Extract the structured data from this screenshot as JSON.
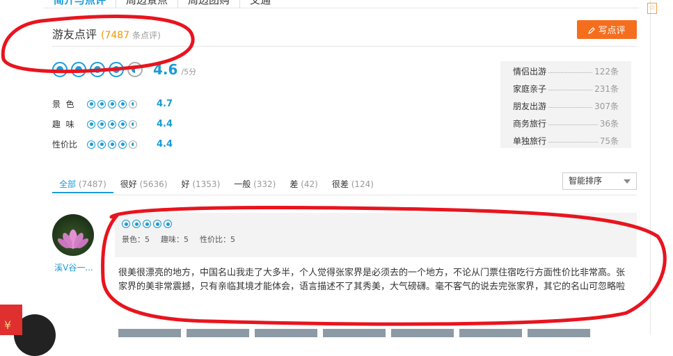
{
  "top_tabs": [
    "简介与点评",
    "周边景点",
    "周边团购",
    "交通"
  ],
  "section": {
    "title": "游友点评",
    "count": "7487",
    "count_unit": "条点评"
  },
  "write_button": {
    "label": "写点评"
  },
  "overall": {
    "score": "4.6",
    "unit": "/5分",
    "rating": 4.6
  },
  "sub_scores": [
    {
      "label": "景  色",
      "score": "4.7"
    },
    {
      "label": "趣  味",
      "score": "4.4"
    },
    {
      "label": "性价比",
      "score": "4.4"
    }
  ],
  "travel_types": [
    {
      "label": "情侣出游",
      "count": "122条"
    },
    {
      "label": "家庭亲子",
      "count": "231条"
    },
    {
      "label": "朋友出游",
      "count": "307条"
    },
    {
      "label": "商务旅行",
      "count": "36条"
    },
    {
      "label": "单独旅行",
      "count": "75条"
    }
  ],
  "filter_tabs": [
    {
      "label": "全部",
      "count": "(7487)"
    },
    {
      "label": "很好",
      "count": "(5636)"
    },
    {
      "label": "好",
      "count": "(1353)"
    },
    {
      "label": "一般",
      "count": "(332)"
    },
    {
      "label": "差",
      "count": "(42)"
    },
    {
      "label": "很差",
      "count": "(124)"
    }
  ],
  "sort": {
    "selected": "智能排序"
  },
  "review": {
    "username": "溪V谷一...",
    "rating": 5,
    "sub_jingse": "景色：5",
    "sub_quwei": "趣味：5",
    "sub_xingjiabi": "性价比：5",
    "text": "很美很漂亮的地方，中国名山我走了大多半，个人觉得张家界是必须去的一个地方，不论从门票住宿吃行方面性价比非常高。张家界的美非常震撼，只有亲临其境才能体会，语言描述不了其秀美，大气磅礴。毫不客气的说去完张家界，其它的名山可忽略啦"
  },
  "corner_icon": {
    "name": "share-icon",
    "glyph": "☆"
  },
  "red_envelope": {
    "glyph": "¥"
  },
  "colors": {
    "accent": "#1a9bd8",
    "orange": "#f39700",
    "button": "#f56e1e",
    "annotation": "#e8141e"
  }
}
